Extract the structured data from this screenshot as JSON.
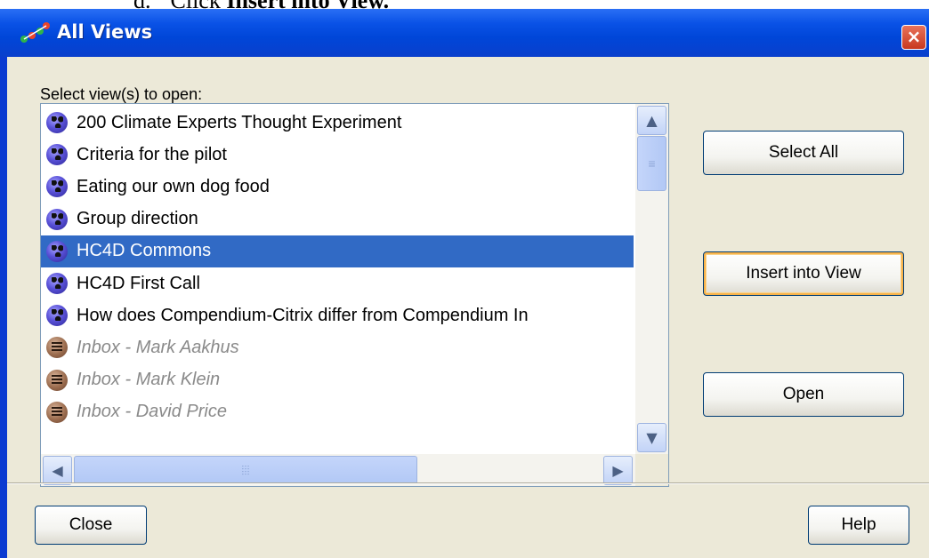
{
  "doc": {
    "prefix": "d.",
    "instruction_prefix": "Click ",
    "instruction_bold": "Insert into View."
  },
  "window": {
    "title": "All Views",
    "close_glyph": "×"
  },
  "dialog": {
    "prompt": "Select view(s) to open:",
    "items": [
      {
        "label": "200 Climate Experts Thought Experiment",
        "icon": "map-icon"
      },
      {
        "label": "Criteria for the pilot",
        "icon": "map-icon"
      },
      {
        "label": "Eating our own dog food",
        "icon": "map-icon"
      },
      {
        "label": "Group direction",
        "icon": "map-icon"
      },
      {
        "label": "HC4D Commons",
        "icon": "map-icon",
        "selected": true
      },
      {
        "label": "HC4D First Call",
        "icon": "map-icon"
      },
      {
        "label": "How does Compendium-Citrix differ from Compendium In",
        "icon": "map-icon"
      },
      {
        "label": "Inbox - Mark Aakhus",
        "icon": "inbox-icon",
        "muted": true
      },
      {
        "label": "Inbox - Mark Klein",
        "icon": "inbox-icon",
        "muted": true
      },
      {
        "label": "Inbox - David Price",
        "icon": "inbox-icon",
        "muted": true
      }
    ],
    "scroll_glyphs": {
      "up": "▲",
      "down": "▼",
      "left": "◀",
      "right": "▶",
      "grip_v": "≡",
      "grip_h": "⦙⦙⦙"
    },
    "buttons": {
      "select_all": "Select All",
      "insert_into_view": "Insert into View",
      "open": "Open",
      "close": "Close",
      "help": "Help"
    }
  },
  "colors": {
    "title_bar": "#0a52e6",
    "selection": "#316ac5",
    "dialog_bg": "#ece9d8"
  }
}
